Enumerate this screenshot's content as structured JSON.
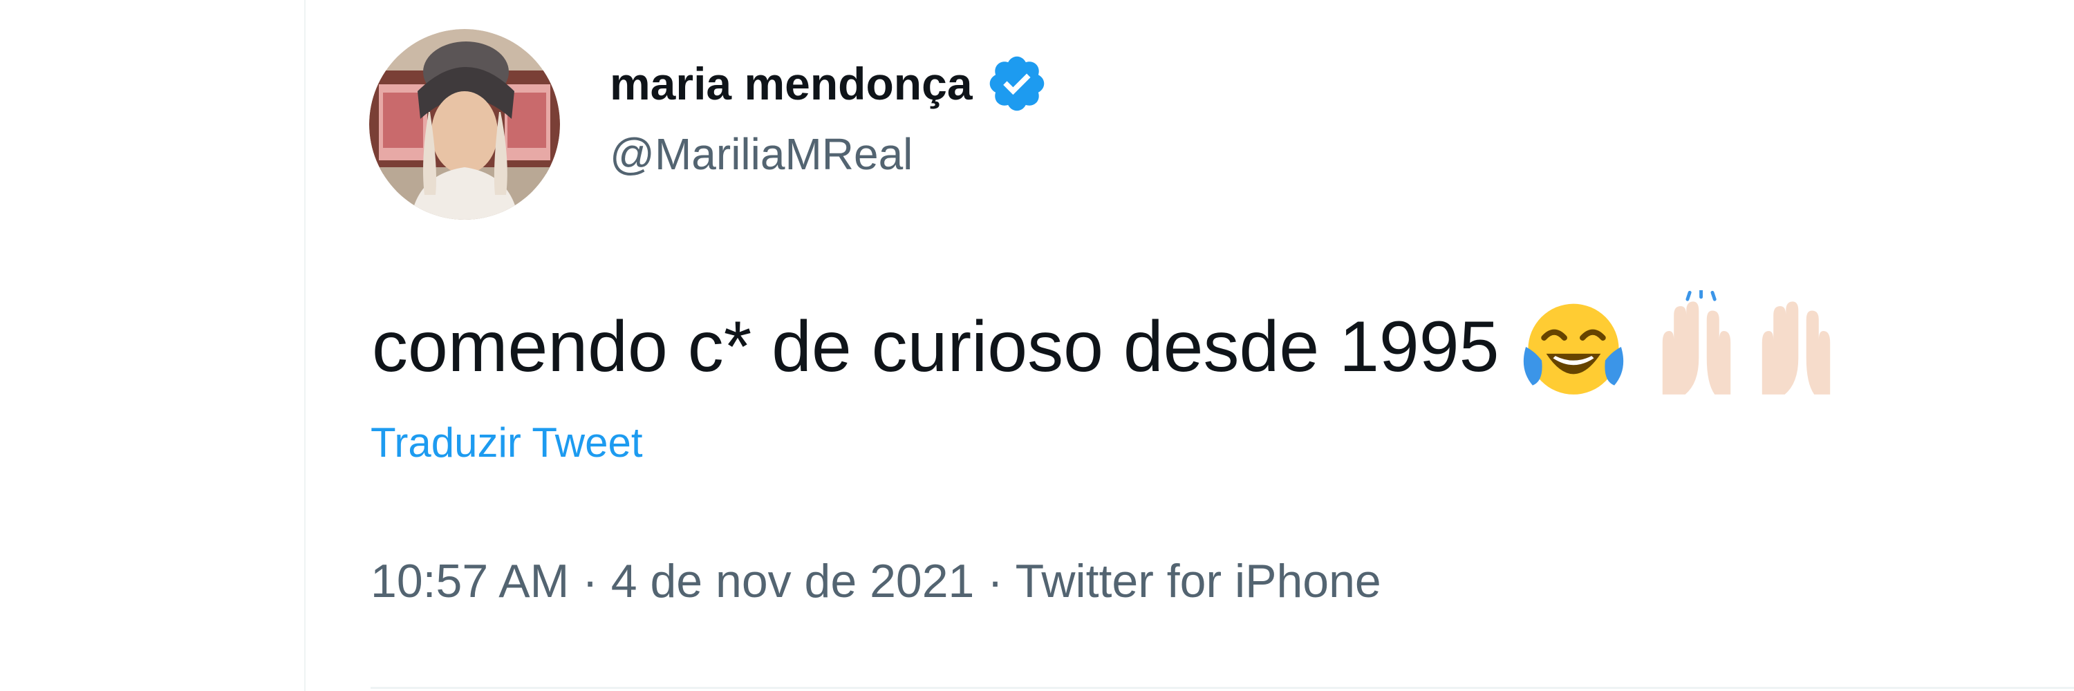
{
  "tweet": {
    "author": {
      "display_name": "maria mendonça",
      "handle": "@MariliaMReal",
      "verified": true,
      "avatar_icon": "profile-photo"
    },
    "text": "comendo c* de curioso desde 1995",
    "emojis": [
      "face-with-tears-of-joy-icon",
      "raising-hands-icon",
      "raising-hands-icon"
    ],
    "translate_label": "Traduzir Tweet",
    "time": "10:57 AM",
    "date": "4 de nov de 2021",
    "source": "Twitter for iPhone",
    "separator": "·"
  },
  "colors": {
    "primary_text": "#0f1419",
    "secondary_text": "#536471",
    "link": "#1d9bf0",
    "verified_badge": "#1d9bf0",
    "divider": "#eff3f4"
  }
}
